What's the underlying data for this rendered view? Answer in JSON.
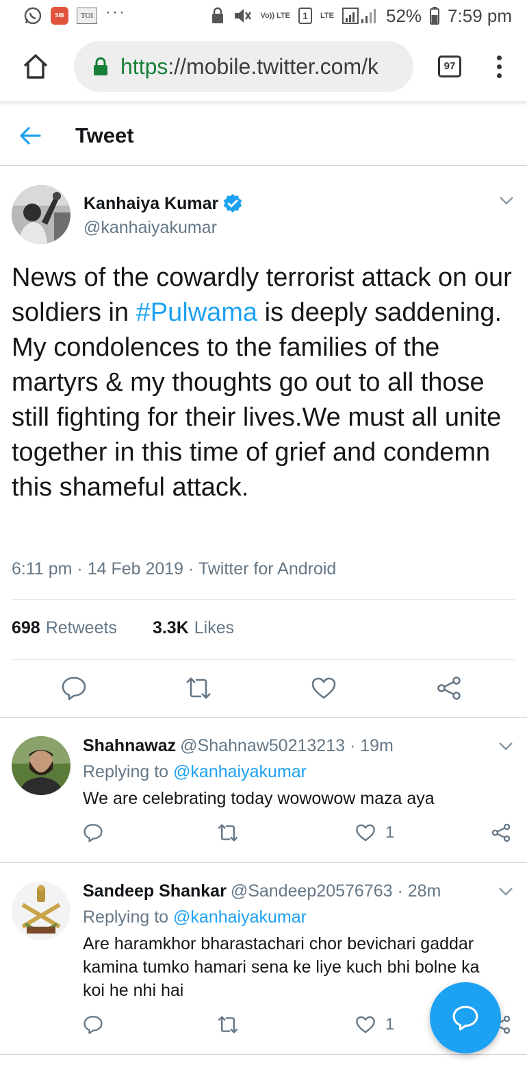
{
  "status_bar": {
    "app_badge": "SIB COMICS",
    "toi": "TOI",
    "volte": "Vo)) LTE",
    "sim": "1",
    "lte": "LTE",
    "battery": "52%",
    "time": "7:59 pm"
  },
  "browser": {
    "url_scheme": "https",
    "url_rest": "://mobile.twitter.com/k",
    "tab_count": "97"
  },
  "header": {
    "title": "Tweet"
  },
  "tweet": {
    "author_name": "Kanhaiya Kumar",
    "author_handle": "@kanhaiyakumar",
    "text_before": "News of the cowardly terrorist attack on our soldiers in ",
    "hashtag": "#Pulwama",
    "text_after": " is deeply saddening. My condolences to the families of the martyrs & my thoughts go out to all those still fighting for their lives.We must all unite together in this time of grief and condemn this shameful attack.",
    "meta": "6:11 pm · 14 Feb 2019 · Twitter for Android",
    "retweets_count": "698",
    "retweets_label": "Retweets",
    "likes_count": "3.3K",
    "likes_label": "Likes"
  },
  "replies": [
    {
      "name": "Shahnawaz",
      "handle": "@Shahnaw50213213",
      "time": " · 19m",
      "replying_label": "Replying to ",
      "replying_to": "@kanhaiyakumar",
      "text": "We are celebrating today wowowow maza aya",
      "likes": "1"
    },
    {
      "name": "Sandeep Shankar",
      "handle": "@Sandeep20576763",
      "time": " · 28m",
      "replying_label": "Replying to ",
      "replying_to": "@kanhaiyakumar",
      "text": "Are haramkhor bharastachari chor bevichari gaddar kamina tumko hamari sena ke liye kuch bhi bolne ka koi he nhi hai",
      "likes": "1"
    }
  ],
  "colors": {
    "accent": "#1da1f2",
    "secondary_text": "#657786",
    "primary_text": "#14171a",
    "secure_green": "#188038"
  },
  "icons": {
    "reply": "reply-icon",
    "retweet": "retweet-icon",
    "like": "heart-icon",
    "share": "share-icon",
    "compose": "compose-reply-icon"
  }
}
